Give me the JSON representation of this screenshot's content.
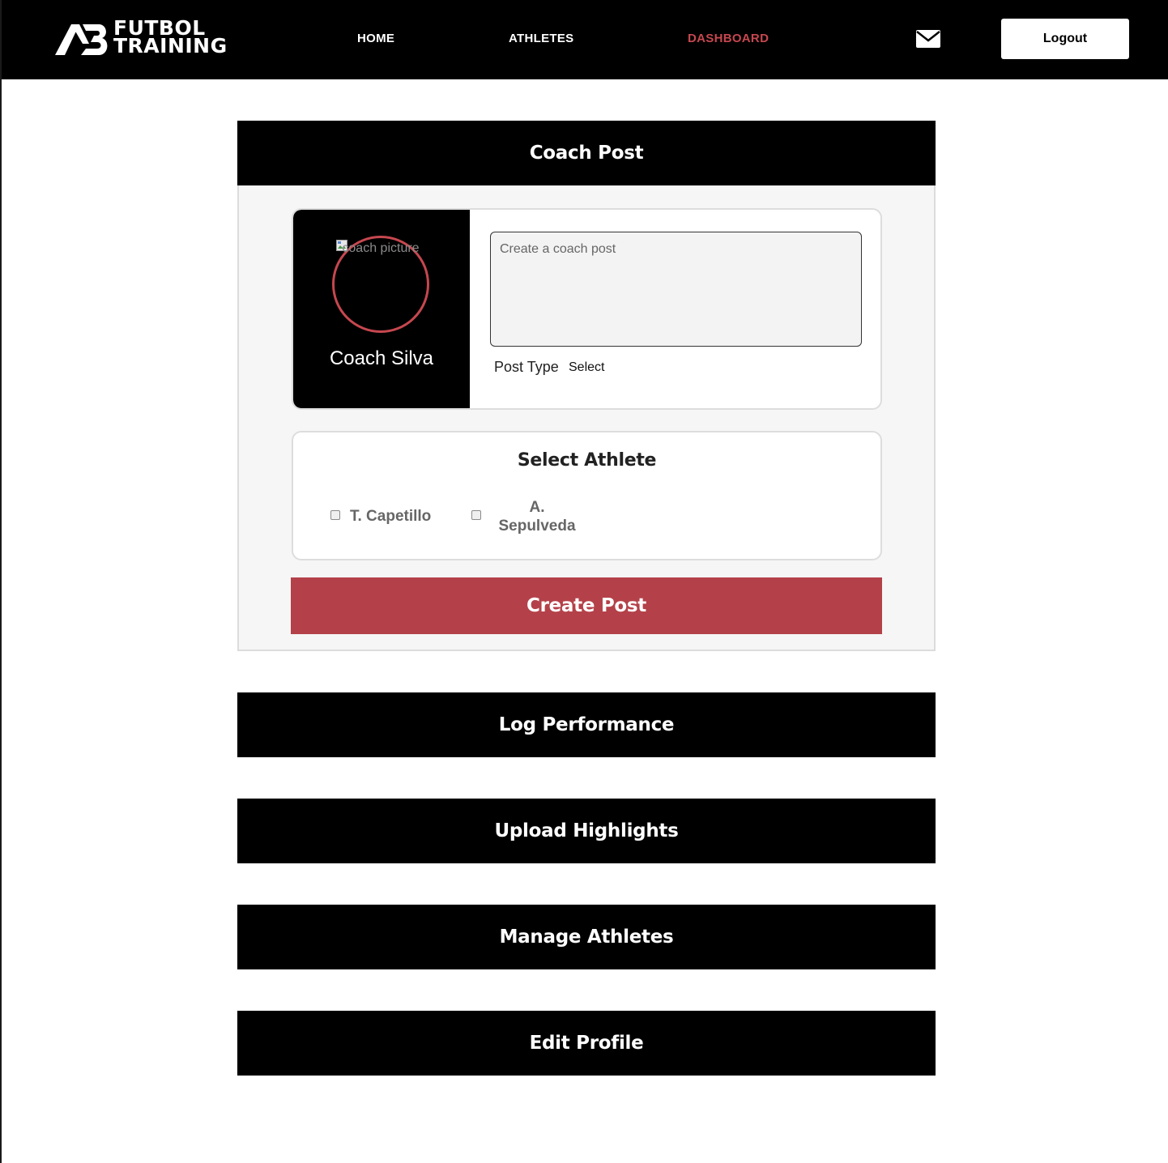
{
  "nav": {
    "logo_icon_text": "AB",
    "logo_line1": "FUTBOL",
    "logo_line2": "TRAINING",
    "links": [
      {
        "label": "HOME",
        "active": false
      },
      {
        "label": "ATHLETES",
        "active": false
      },
      {
        "label": "DASHBOARD",
        "active": true
      }
    ],
    "mail_icon": "mail-icon",
    "logout_label": "Logout"
  },
  "coach_post": {
    "header": "Coach Post",
    "avatar_alt": "coach picture",
    "coach_name": "Coach Silva",
    "textarea_placeholder": "Create a coach post",
    "post_type_label": "Post Type",
    "post_type_value": "Select",
    "select_athlete_title": "Select Athlete",
    "athletes": [
      {
        "name": "T. Capetillo",
        "checked": false
      },
      {
        "name_line1": "A.",
        "name_line2": "Sepulveda",
        "checked": false
      }
    ],
    "create_button": "Create Post"
  },
  "sections": [
    {
      "label": "Log Performance"
    },
    {
      "label": "Upload Highlights"
    },
    {
      "label": "Manage Athletes"
    },
    {
      "label": "Edit Profile"
    }
  ],
  "colors": {
    "accent": "#b44149",
    "active_nav": "#c6474f",
    "header_bg": "#000000",
    "panel_bg": "#f6f6f6"
  }
}
